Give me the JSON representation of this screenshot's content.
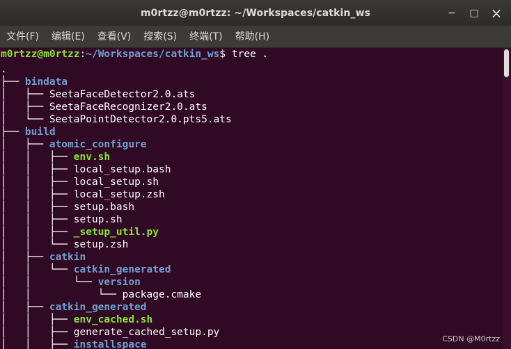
{
  "window": {
    "title": "m0rtzz@m0rtzz: ~/Workspaces/catkin_ws",
    "minimize_glyph": "−",
    "maximize_glyph": "□",
    "close_glyph": "×"
  },
  "menu": [
    "文件(F)",
    "编辑(E)",
    "查看(V)",
    "搜索(S)",
    "终端(T)",
    "帮助(H)"
  ],
  "prompt": {
    "user_host": "m0rtzz@m0rtzz",
    "sep": ":",
    "path": "~/Workspaces/catkin_ws",
    "dollar": "$ ",
    "command": "tree ."
  },
  "tree": [
    {
      "prefix": "",
      "name": ".",
      "kind": "file"
    },
    {
      "prefix": "├── ",
      "name": "bindata",
      "kind": "dir"
    },
    {
      "prefix": "│   ├── ",
      "name": "SeetaFaceDetector2.0.ats",
      "kind": "file"
    },
    {
      "prefix": "│   ├── ",
      "name": "SeetaFaceRecognizer2.0.ats",
      "kind": "file"
    },
    {
      "prefix": "│   └── ",
      "name": "SeetaPointDetector2.0.pts5.ats",
      "kind": "file"
    },
    {
      "prefix": "├── ",
      "name": "build",
      "kind": "dir"
    },
    {
      "prefix": "│   ├── ",
      "name": "atomic_configure",
      "kind": "dir"
    },
    {
      "prefix": "│   │   ├── ",
      "name": "env.sh",
      "kind": "exe"
    },
    {
      "prefix": "│   │   ├── ",
      "name": "local_setup.bash",
      "kind": "file"
    },
    {
      "prefix": "│   │   ├── ",
      "name": "local_setup.sh",
      "kind": "file"
    },
    {
      "prefix": "│   │   ├── ",
      "name": "local_setup.zsh",
      "kind": "file"
    },
    {
      "prefix": "│   │   ├── ",
      "name": "setup.bash",
      "kind": "file"
    },
    {
      "prefix": "│   │   ├── ",
      "name": "setup.sh",
      "kind": "file"
    },
    {
      "prefix": "│   │   ├── ",
      "name": "_setup_util.py",
      "kind": "exe"
    },
    {
      "prefix": "│   │   └── ",
      "name": "setup.zsh",
      "kind": "file"
    },
    {
      "prefix": "│   ├── ",
      "name": "catkin",
      "kind": "dir"
    },
    {
      "prefix": "│   │   └── ",
      "name": "catkin_generated",
      "kind": "dir"
    },
    {
      "prefix": "│   │       └── ",
      "name": "version",
      "kind": "dir"
    },
    {
      "prefix": "│   │           └── ",
      "name": "package.cmake",
      "kind": "file"
    },
    {
      "prefix": "│   ├── ",
      "name": "catkin_generated",
      "kind": "dir"
    },
    {
      "prefix": "│   │   ├── ",
      "name": "env_cached.sh",
      "kind": "exe"
    },
    {
      "prefix": "│   │   ├── ",
      "name": "generate_cached_setup.py",
      "kind": "file"
    },
    {
      "prefix": "│   │   ├── ",
      "name": "installspace",
      "kind": "dir"
    }
  ],
  "watermark": "CSDN @M0rtzz"
}
